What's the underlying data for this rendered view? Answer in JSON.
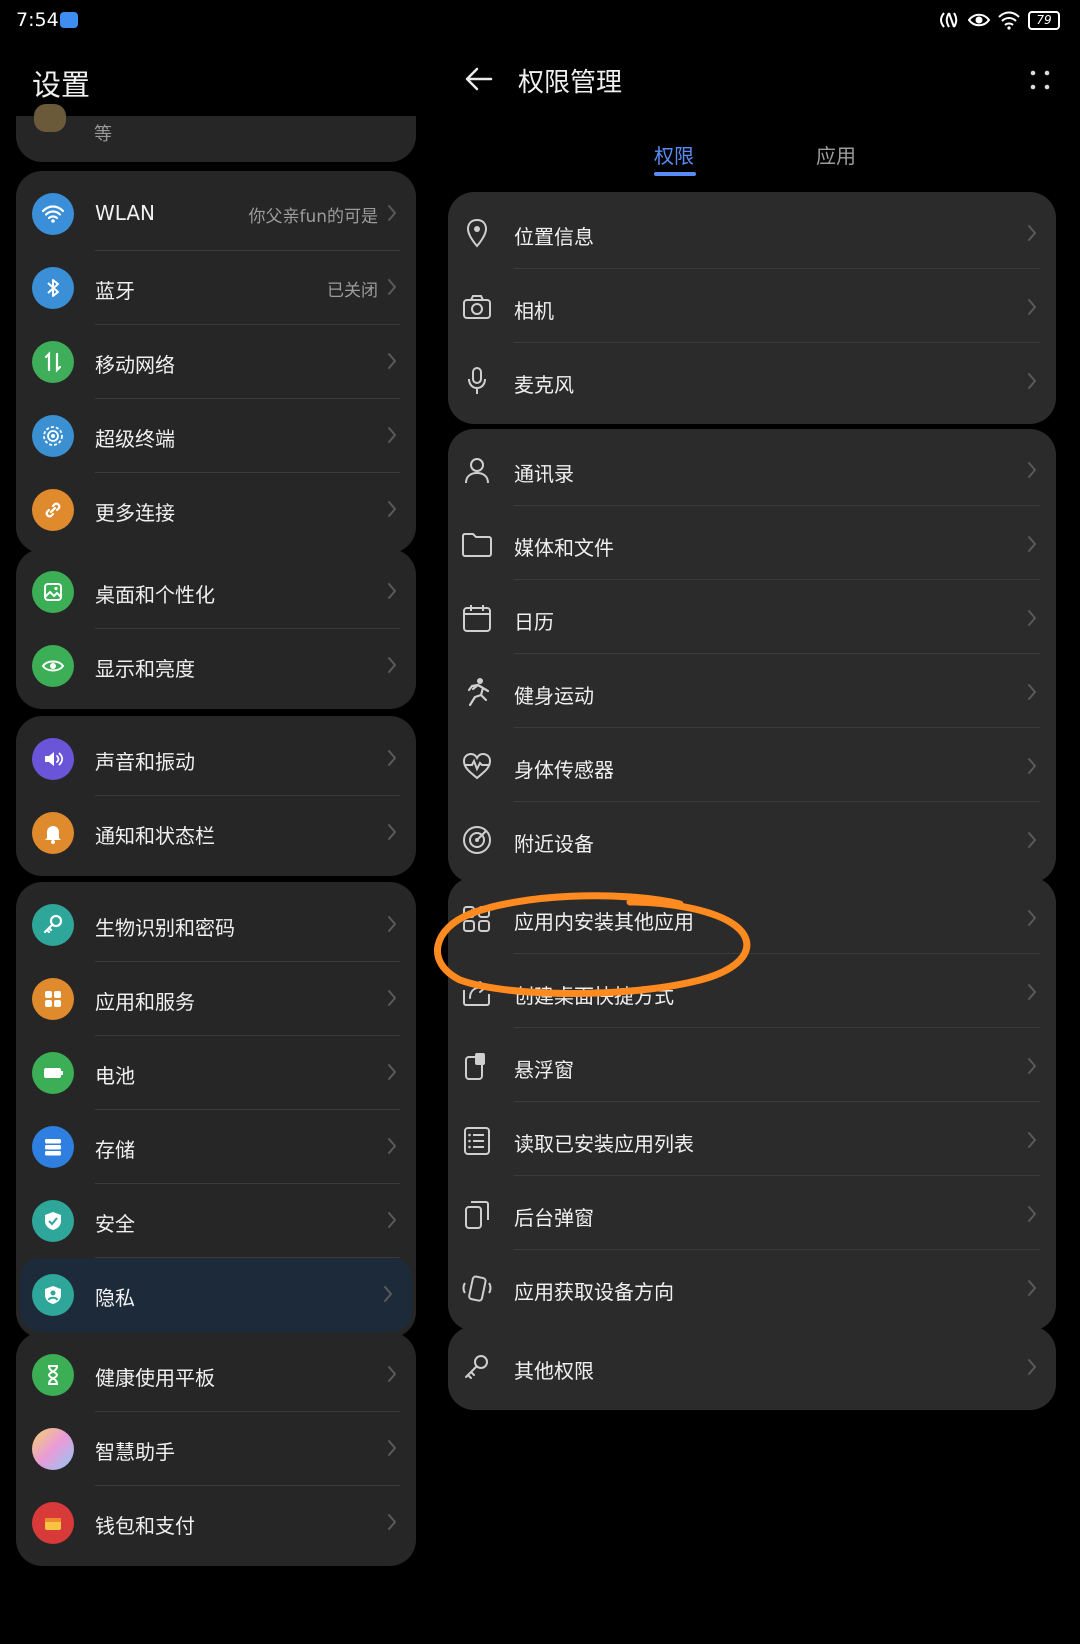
{
  "status_bar": {
    "time": "7:54",
    "battery": "79"
  },
  "left_panel": {
    "title": "设置",
    "partial_item_text": "等",
    "groups": [
      [
        {
          "label": "WLAN",
          "value": "你父亲fun的可是",
          "icon": "wifi-icon",
          "color": "#3b8fd9"
        },
        {
          "label": "蓝牙",
          "value": "已关闭",
          "icon": "bluetooth-icon",
          "color": "#3a8fd6"
        },
        {
          "label": "移动网络",
          "value": "",
          "icon": "mobile-network-icon",
          "color": "#3fae5a"
        },
        {
          "label": "超级终端",
          "value": "",
          "icon": "super-device-icon",
          "color": "#3a90d0"
        },
        {
          "label": "更多连接",
          "value": "",
          "icon": "link-icon",
          "color": "#e08a2e"
        }
      ],
      [
        {
          "label": "桌面和个性化",
          "value": "",
          "icon": "wallpaper-icon",
          "color": "#3caf56"
        },
        {
          "label": "显示和亮度",
          "value": "",
          "icon": "eye-icon",
          "color": "#3caf56"
        }
      ],
      [
        {
          "label": "声音和振动",
          "value": "",
          "icon": "speaker-icon",
          "color": "#6a55d8"
        },
        {
          "label": "通知和状态栏",
          "value": "",
          "icon": "bell-icon",
          "color": "#e08a2e"
        }
      ],
      [
        {
          "label": "生物识别和密码",
          "value": "",
          "icon": "key-icon",
          "color": "#2fa69a"
        },
        {
          "label": "应用和服务",
          "value": "",
          "icon": "apps-icon",
          "color": "#e08a2e"
        },
        {
          "label": "电池",
          "value": "",
          "icon": "battery-icon",
          "color": "#3caf56"
        },
        {
          "label": "存储",
          "value": "",
          "icon": "storage-icon",
          "color": "#2f7fe0"
        },
        {
          "label": "安全",
          "value": "",
          "icon": "shield-icon",
          "color": "#2fa69a"
        },
        {
          "label": "隐私",
          "value": "",
          "icon": "privacy-icon",
          "color": "#2fa69a",
          "selected": true
        }
      ],
      [
        {
          "label": "健康使用平板",
          "value": "",
          "icon": "hourglass-icon",
          "color": "#3caf56"
        },
        {
          "label": "智慧助手",
          "value": "",
          "icon": "assistant-icon",
          "color": "#d79bd4"
        },
        {
          "label": "钱包和支付",
          "value": "",
          "icon": "wallet-icon",
          "color": "#d83a3a"
        }
      ]
    ]
  },
  "right_panel": {
    "title": "权限管理",
    "tabs": {
      "active": "权限",
      "other": "应用"
    },
    "groups": [
      [
        {
          "label": "位置信息",
          "icon": "location-icon"
        },
        {
          "label": "相机",
          "icon": "camera-icon"
        },
        {
          "label": "麦克风",
          "icon": "microphone-icon"
        }
      ],
      [
        {
          "label": "通讯录",
          "icon": "contacts-icon"
        },
        {
          "label": "媒体和文件",
          "icon": "folder-icon"
        },
        {
          "label": "日历",
          "icon": "calendar-icon"
        },
        {
          "label": "健身运动",
          "icon": "running-icon"
        },
        {
          "label": "身体传感器",
          "icon": "heart-rate-icon"
        },
        {
          "label": "附近设备",
          "icon": "nearby-icon"
        }
      ],
      [
        {
          "label": "应用内安装其他应用",
          "icon": "install-apps-icon"
        },
        {
          "label": "创建桌面快捷方式",
          "icon": "shortcut-icon"
        },
        {
          "label": "悬浮窗",
          "icon": "floating-window-icon"
        },
        {
          "label": "读取已安装应用列表",
          "icon": "app-list-icon"
        },
        {
          "label": "后台弹窗",
          "icon": "popup-icon"
        },
        {
          "label": "应用获取设备方向",
          "icon": "orientation-icon"
        }
      ],
      [
        {
          "label": "其他权限",
          "icon": "other-permission-icon"
        }
      ]
    ]
  },
  "colors": {
    "accent": "#5b8cf5",
    "highlight": "#ff8a1f"
  }
}
